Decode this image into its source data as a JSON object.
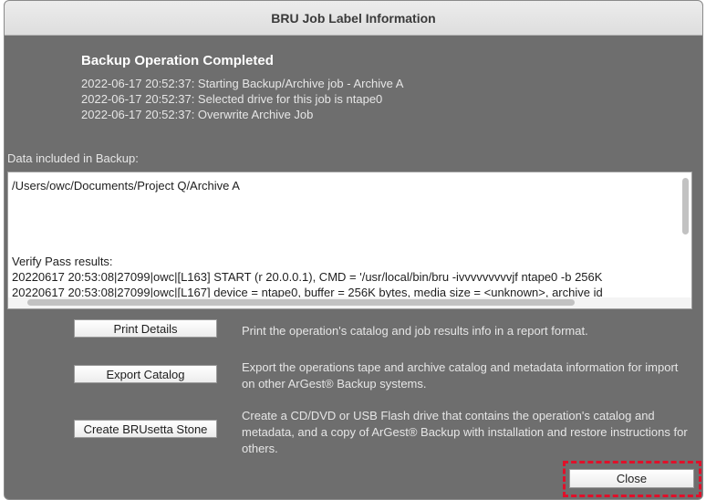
{
  "window": {
    "title": "BRU Job Label Information"
  },
  "status": {
    "heading": "Backup Operation Completed",
    "lines": [
      "2022-06-17 20:52:37: Starting Backup/Archive job - Archive A",
      "2022-06-17 20:52:37: Selected drive for this job is ntape0",
      "2022-06-17 20:52:37: Overwrite Archive Job"
    ]
  },
  "data_section": {
    "label": "Data included in Backup:",
    "path": "/Users/owc/Documents/Project Q/Archive A",
    "verify_heading": "Verify Pass results:",
    "verify_lines": [
      "20220617 20:53:08|27099|owc|[L163] START (r 20.0.0.1), CMD = '/usr/local/bin/bru -ivvvvvvvvvjf ntape0 -b 256K",
      "20220617 20:53:08|27099|owc|[L167] device = ntape0, buffer = 256K bytes, media size = <unknown>, archive id"
    ]
  },
  "actions": [
    {
      "label": "Print Details",
      "description": "Print the operation's catalog and job results info in a report format."
    },
    {
      "label": "Export Catalog",
      "description": "Export the operations tape and archive catalog and metadata information for import on other ArGest® Backup systems."
    },
    {
      "label": "Create BRUsetta Stone",
      "description": "Create a CD/DVD or USB Flash drive that contains the operation's catalog and metadata, and a copy of ArGest® Backup with installation and restore instructions for others."
    }
  ],
  "close_label": "Close",
  "colors": {
    "highlight": "#e0102a",
    "background": "#6e6e6e"
  }
}
